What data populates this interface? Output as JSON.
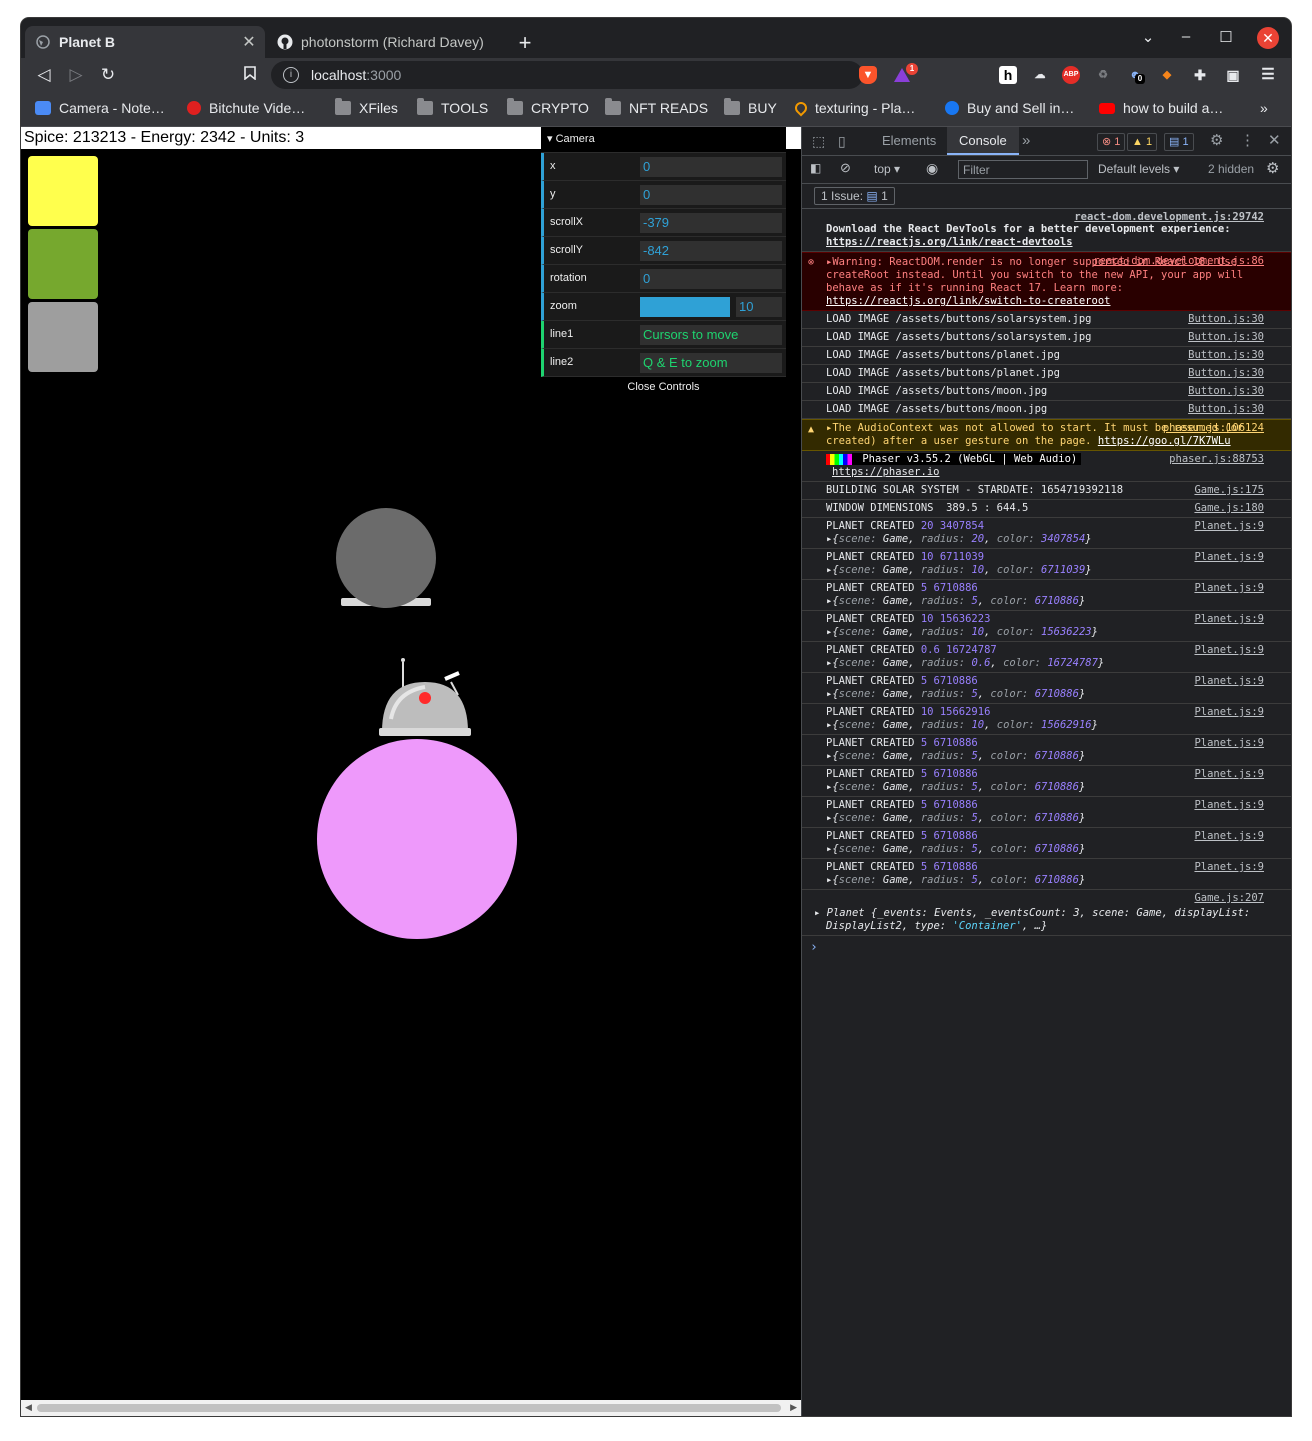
{
  "browser": {
    "tabs": [
      {
        "title": "Planet B",
        "active": true
      },
      {
        "title": "photonstorm (Richard Davey)",
        "active": false
      }
    ],
    "new_tab": "+",
    "url_host": "localhost",
    "url_port": ":3000",
    "bookmarks": [
      {
        "label": "Camera - Note…",
        "icon": "puzzle-icon"
      },
      {
        "label": "Bitchute Vide…",
        "icon": "bitchute-icon"
      },
      {
        "label": "XFiles",
        "icon": "folder-icon"
      },
      {
        "label": "TOOLS",
        "icon": "folder-icon"
      },
      {
        "label": "CRYPTO",
        "icon": "folder-icon"
      },
      {
        "label": "NFT READS",
        "icon": "folder-icon"
      },
      {
        "label": "BUY",
        "icon": "folder-icon"
      },
      {
        "label": "texturing - Pla…",
        "icon": "location-icon"
      },
      {
        "label": "Buy and Sell in…",
        "icon": "facebook-icon"
      },
      {
        "label": "how to build a…",
        "icon": "youtube-icon"
      }
    ],
    "more_bookmarks": "»",
    "extensions": {
      "abp": "ABP",
      "h": "h",
      "notif_count": "1",
      "ghost_count": "0"
    }
  },
  "game": {
    "hud": "Spice: 213213 - Energy: 2342 - Units: 3",
    "buttons": [
      {
        "name": "solarsystem",
        "color": "#ffff4d"
      },
      {
        "name": "planet",
        "color": "#76a82e"
      },
      {
        "name": "moon",
        "color": "#9e9e9e"
      }
    ],
    "gui": {
      "folder": "Camera",
      "rows": [
        {
          "label": "x",
          "value": "0"
        },
        {
          "label": "y",
          "value": "0"
        },
        {
          "label": "scrollX",
          "value": "-379"
        },
        {
          "label": "scrollY",
          "value": "-842"
        },
        {
          "label": "rotation",
          "value": "0"
        }
      ],
      "zoom": {
        "label": "zoom",
        "value": "10",
        "fill_fraction": 1.0
      },
      "strings": [
        {
          "label": "line1",
          "value": "Cursors to move"
        },
        {
          "label": "line2",
          "value": "Q & E to zoom"
        }
      ],
      "close": "Close Controls"
    },
    "colors": {
      "small_planet": "#6b6b6b",
      "big_planet": "#ee99fb"
    }
  },
  "devtools": {
    "tabs": [
      "Elements",
      "Console"
    ],
    "active_tab": "Console",
    "badges": {
      "errors": "1",
      "warnings": "1",
      "messages": "1"
    },
    "context": "top",
    "filter_placeholder": "Filter",
    "levels": "Default levels",
    "hidden": "2 hidden",
    "issues": "1 Issue:",
    "issues_count": "1",
    "console": {
      "react_devtools": {
        "src": "react-dom.development.js:29742",
        "text": "Download the React DevTools for a better development experience: ",
        "link": "https://reactjs.org/link/react-devtools"
      },
      "error": {
        "src": "react-dom.development.js:86",
        "text": "Warning: ReactDOM.render is no longer supported in React 18. Use createRoot instead. Until you switch to the new API, your app will behave as if it's running React 17. Learn more: ",
        "link": "https://reactjs.org/link/switch-to-createroot"
      },
      "load_images": [
        {
          "text": "LOAD IMAGE /assets/buttons/solarsystem.jpg",
          "src": "Button.js:30"
        },
        {
          "text": "LOAD IMAGE /assets/buttons/solarsystem.jpg",
          "src": "Button.js:30"
        },
        {
          "text": "LOAD IMAGE /assets/buttons/planet.jpg",
          "src": "Button.js:30"
        },
        {
          "text": "LOAD IMAGE /assets/buttons/planet.jpg",
          "src": "Button.js:30"
        },
        {
          "text": "LOAD IMAGE /assets/buttons/moon.jpg",
          "src": "Button.js:30"
        },
        {
          "text": "LOAD IMAGE /assets/buttons/moon.jpg",
          "src": "Button.js:30"
        }
      ],
      "warning": {
        "src": "phaser.js:106124",
        "text": "The AudioContext was not allowed to start. It must be resumed (or created) after a user gesture on the page. ",
        "link": "https://goo.gl/7K7WLu"
      },
      "phaser": {
        "src": "phaser.js:88753",
        "banner": " Phaser v3.55.2 (WebGL | Web Audio) ",
        "link": "https://phaser.io"
      },
      "building": {
        "text": "BUILDING SOLAR SYSTEM - STARDATE: 1654719392118",
        "src": "Game.js:175"
      },
      "window_dims": {
        "text": "WINDOW DIMENSIONS  389.5 : 644.5",
        "src": "Game.js:180"
      },
      "planets": [
        {
          "radius": "20",
          "color": "3407854"
        },
        {
          "radius": "10",
          "color": "6711039"
        },
        {
          "radius": "5",
          "color": "6710886"
        },
        {
          "radius": "10",
          "color": "15636223"
        },
        {
          "radius": "0.6",
          "color": "16724787"
        },
        {
          "radius": "5",
          "color": "6710886"
        },
        {
          "radius": "10",
          "color": "15662916"
        },
        {
          "radius": "5",
          "color": "6710886"
        },
        {
          "radius": "5",
          "color": "6710886"
        },
        {
          "radius": "5",
          "color": "6710886"
        },
        {
          "radius": "5",
          "color": "6710886"
        },
        {
          "radius": "5",
          "color": "6710886"
        }
      ],
      "planet_label": "PLANET CREATED",
      "planet_src": "Planet.js:9",
      "final": {
        "src": "Game.js:207",
        "text1": "Planet {_events: ",
        "text2": "Events, _eventsCount: 3, scene: Game, displayList: DisplayList2, type: ",
        "type_str": "'Container'",
        "tail": ", …}"
      },
      "prompt": "›"
    }
  }
}
